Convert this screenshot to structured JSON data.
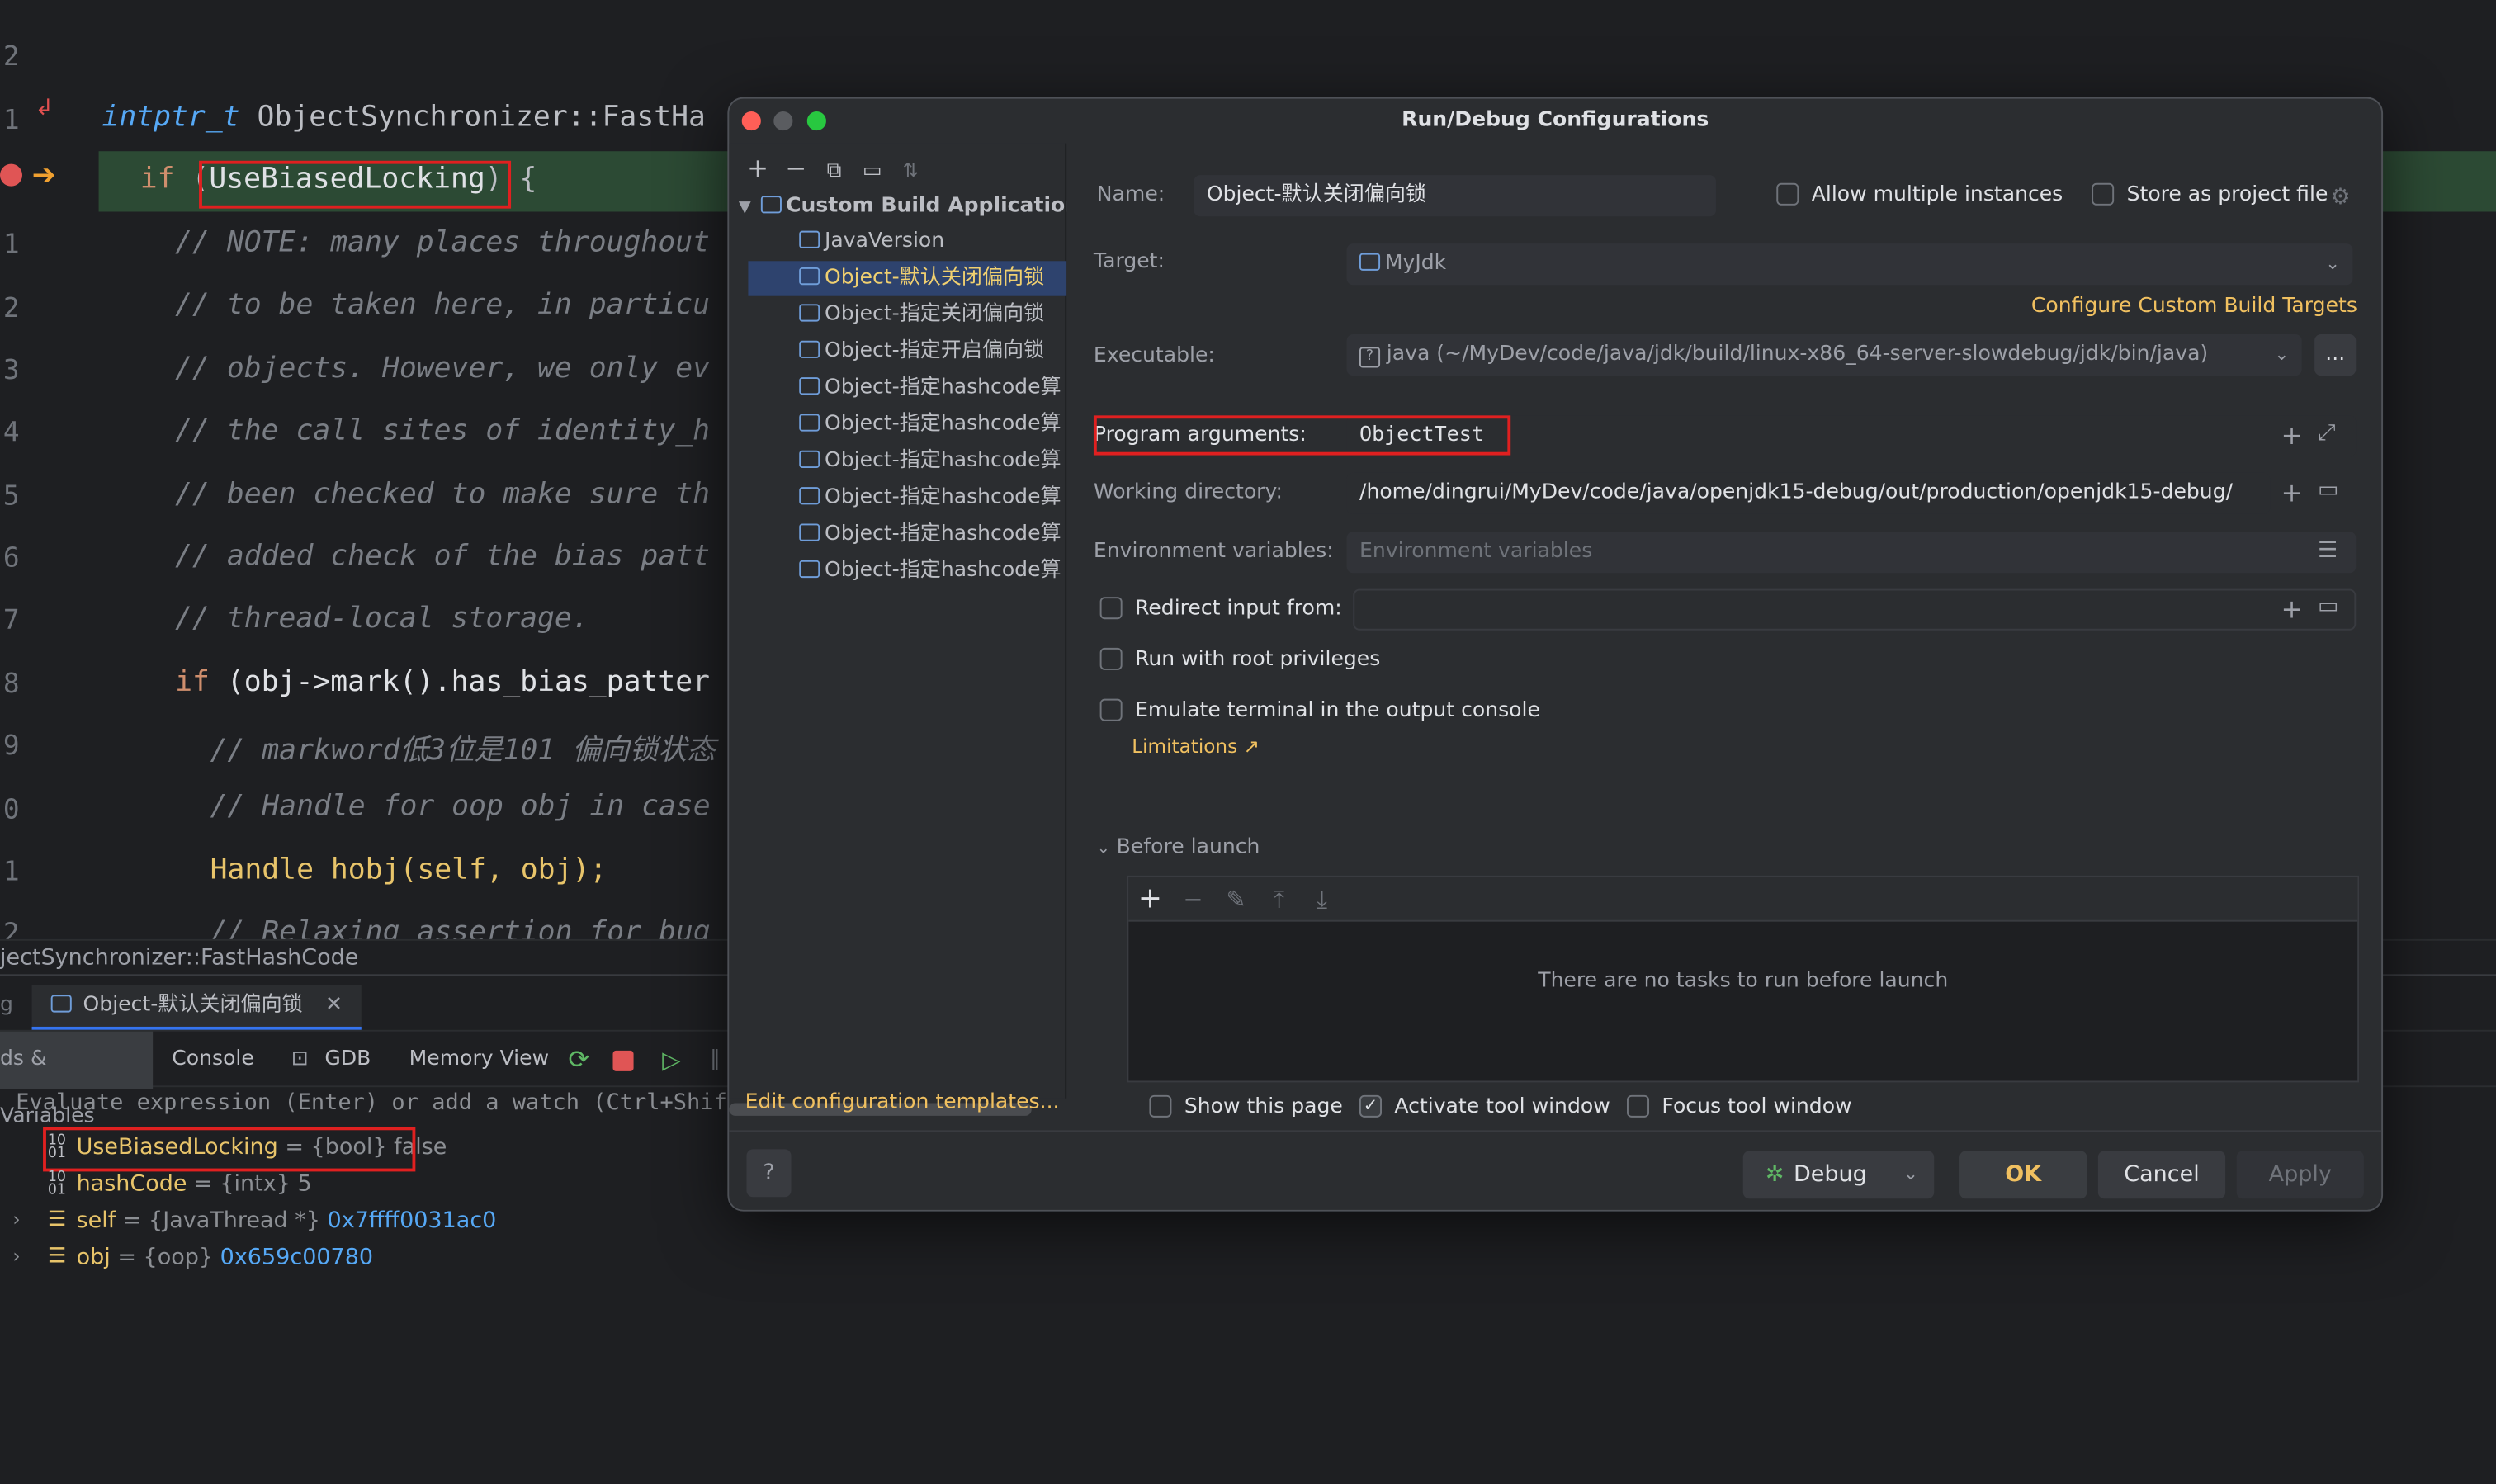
{
  "editor": {
    "line_numbers": [
      "2",
      "1",
      "",
      "1",
      "2",
      "3",
      "4",
      "5",
      "6",
      "7",
      "8",
      "9",
      "0",
      "1",
      "2"
    ],
    "lines": {
      "l1_type": "intptr_t",
      "l1_rest": " ObjectSynchronizer::FastHa",
      "l2_kw": "if",
      "l2_open": " (",
      "l2_ident": "UseBiasedLocking",
      "l2_close": ") {",
      "c1": "// NOTE: many places throughout",
      "c2": "// to be taken here, in particu",
      "c3": "// objects. However, we only ev",
      "c4": "// the call sites of identity_h",
      "c5": "// been checked to make sure th",
      "c6": "// added check of the bias patt",
      "c7": "// thread-local storage.",
      "l10_kw": "if",
      "l10_rest": " (obj->mark().has_bias_patter",
      "c8": "// markword低3位是101 偏向锁状态",
      "c9": "// Handle for oop obj in case",
      "l13": "Handle hobj(self, obj);",
      "c10": "// Relaxing assertion for bug"
    },
    "breadcrumb": "jectSynchronizer::FastHashCode"
  },
  "debug": {
    "session_tab": "Object-默认关闭偏向锁",
    "tabs": {
      "threads": "ds & Variables",
      "console": "Console",
      "gdb": "GDB",
      "memory": "Memory View"
    },
    "eval_placeholder": "Evaluate expression (Enter) or add a watch (Ctrl+Shift",
    "variables": [
      {
        "name": "UseBiasedLocking",
        "type": " = {bool} ",
        "value": "false"
      },
      {
        "name": "hashCode",
        "type": " = {intx} ",
        "value": "5"
      },
      {
        "name": "self",
        "type": " = {JavaThread *} ",
        "value": "0x7ffff0031ac0"
      },
      {
        "name": "obj",
        "type": " = {oop} ",
        "value": "0x659c00780"
      }
    ]
  },
  "dialog": {
    "title": "Run/Debug Configurations",
    "tree": {
      "group": "Custom Build Application",
      "items": [
        "JavaVersion",
        "Object-默认关闭偏向锁",
        "Object-指定关闭偏向锁",
        "Object-指定开启偏向锁",
        "Object-指定hashcode算",
        "Object-指定hashcode算",
        "Object-指定hashcode算",
        "Object-指定hashcode算",
        "Object-指定hashcode算",
        "Object-指定hashcode算"
      ]
    },
    "edit_templates": "Edit configuration templates...",
    "name_label": "Name:",
    "name_value": "Object-默认关闭偏向锁",
    "allow_multiple": "Allow multiple instances",
    "store_project": "Store as project file",
    "target_label": "Target:",
    "target_value": "MyJdk",
    "configure_targets": "Configure Custom Build Targets",
    "executable_label": "Executable:",
    "executable_value": "java (~/MyDev/code/java/jdk/build/linux-x86_64-server-slowdebug/jdk/bin/java)",
    "more_button": "...",
    "program_args_label": "Program arguments:",
    "program_args_value": "ObjectTest",
    "working_dir_label": "Working directory:",
    "working_dir_value": "/home/dingrui/MyDev/code/java/openjdk15-debug/out/production/openjdk15-debug/",
    "env_label": "Environment variables:",
    "env_placeholder": "Environment variables",
    "redirect_input": "Redirect input from:",
    "run_root": "Run with root privileges",
    "emulate_terminal": "Emulate terminal in the output console",
    "limitations": "Limitations ↗",
    "before_launch": "Before launch",
    "no_tasks": "There are no tasks to run before launch",
    "show_page": "Show this page",
    "activate_tool": "Activate tool window",
    "focus_tool": "Focus tool window",
    "help": "?",
    "debug_select": "Debug",
    "ok": "OK",
    "cancel": "Cancel",
    "apply": "Apply"
  },
  "colors": {
    "accent": "#3574f0",
    "highlight_box": "#e02020",
    "link": "#f0c060"
  }
}
